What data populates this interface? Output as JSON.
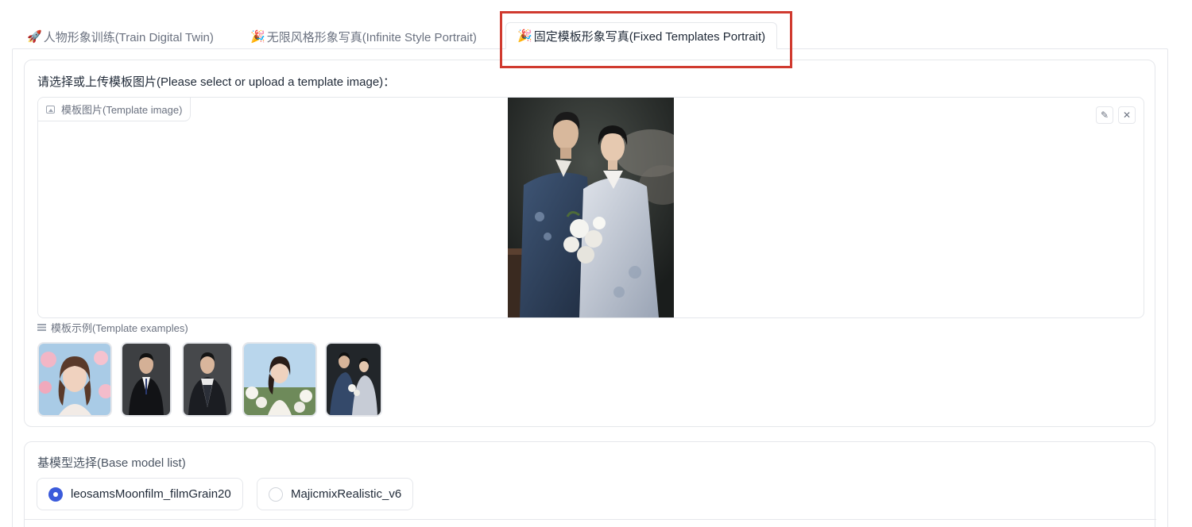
{
  "tabs": [
    {
      "icon": "rocket-icon",
      "emoji": "🚀",
      "label": "人物形象训练(Train Digital Twin)",
      "active": false
    },
    {
      "icon": "party-popper-icon",
      "emoji": "🎉",
      "label": "无限风格形象写真(Infinite Style Portrait)",
      "active": false
    },
    {
      "icon": "party-popper-icon",
      "emoji": "🎉",
      "label": "固定模板形象写真(Fixed Templates Portrait)",
      "active": true
    }
  ],
  "highlight_color": "#d03a2f",
  "template": {
    "select_label": "请选择或上传模板图片(Please select or upload a template image)：",
    "image_tag": "模板图片(Template image)",
    "image_icon": "image-icon",
    "edit_icon": "pencil-icon",
    "clear_icon": "close-icon",
    "examples_label": "模板示例(Template examples)",
    "examples_icon": "list-icon",
    "examples": [
      {
        "name": "girl-flowers-beach"
      },
      {
        "name": "man-black-suit"
      },
      {
        "name": "man-suit-vest"
      },
      {
        "name": "woman-white-dress-flowers"
      },
      {
        "name": "couple-hanbok"
      }
    ]
  },
  "base_model": {
    "label": "基模型选择(Base model list)",
    "options": [
      {
        "label": "leosamsMoonfilm_filmGrain20",
        "selected": true
      },
      {
        "label": "MajicmixRealistic_v6",
        "selected": false
      }
    ],
    "accent": "#3b5bdb"
  }
}
